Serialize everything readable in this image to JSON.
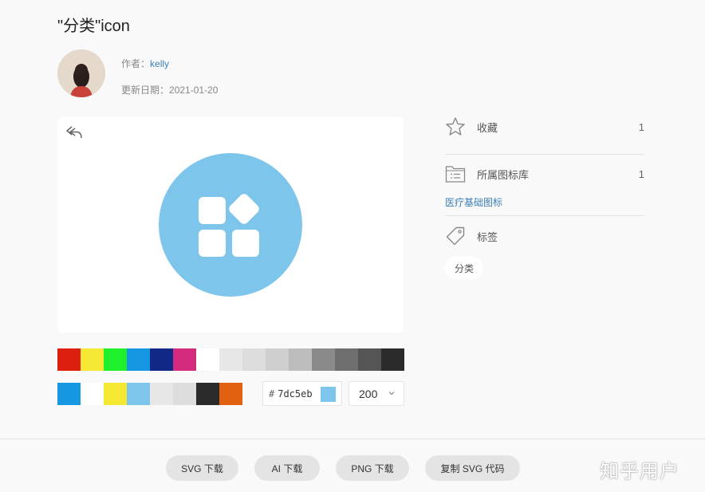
{
  "page": {
    "title": "\"分类\"icon"
  },
  "meta": {
    "author_label": "作者：",
    "author_name": "kelly",
    "date_label": "更新日期：",
    "date_value": "2021-01-20"
  },
  "preview": {
    "icon_color": "#7dc5eb",
    "undo_icon": "undo-icon",
    "icon_name": "category-icon"
  },
  "palette": {
    "colors": [
      "#dd1f10",
      "#f4e832",
      "#1ef02c",
      "#1597e2",
      "#122886",
      "#d42b7e",
      "#ffffff",
      "#e7e7e7",
      "#dddddd",
      "#cfcfcf",
      "#bdbdbd",
      "#8a8a8a",
      "#6e6e6e",
      "#555555",
      "#2b2b2b"
    ]
  },
  "recent_colors": [
    "#1597e2",
    "#ffffff",
    "#f4e832",
    "#7dc5eb",
    "#e7e7e7",
    "#dddddd",
    "#2b2b2b",
    "#e16110"
  ],
  "color_picker": {
    "hash": "#",
    "value": "7dc5eb",
    "swatch": "#7dc5eb"
  },
  "size_select": {
    "value": "200"
  },
  "sidebar": {
    "favorite_label": "收藏",
    "favorite_count": "1",
    "library_label": "所属图标库",
    "library_count": "1",
    "library_link": "医疗基础图标",
    "tags_label": "标签",
    "tag": "分类"
  },
  "footer": {
    "svg_download": "SVG 下载",
    "ai_download": "AI 下载",
    "png_download": "PNG 下载",
    "copy_svg": "复制 SVG 代码",
    "watermark": "知乎用户"
  }
}
